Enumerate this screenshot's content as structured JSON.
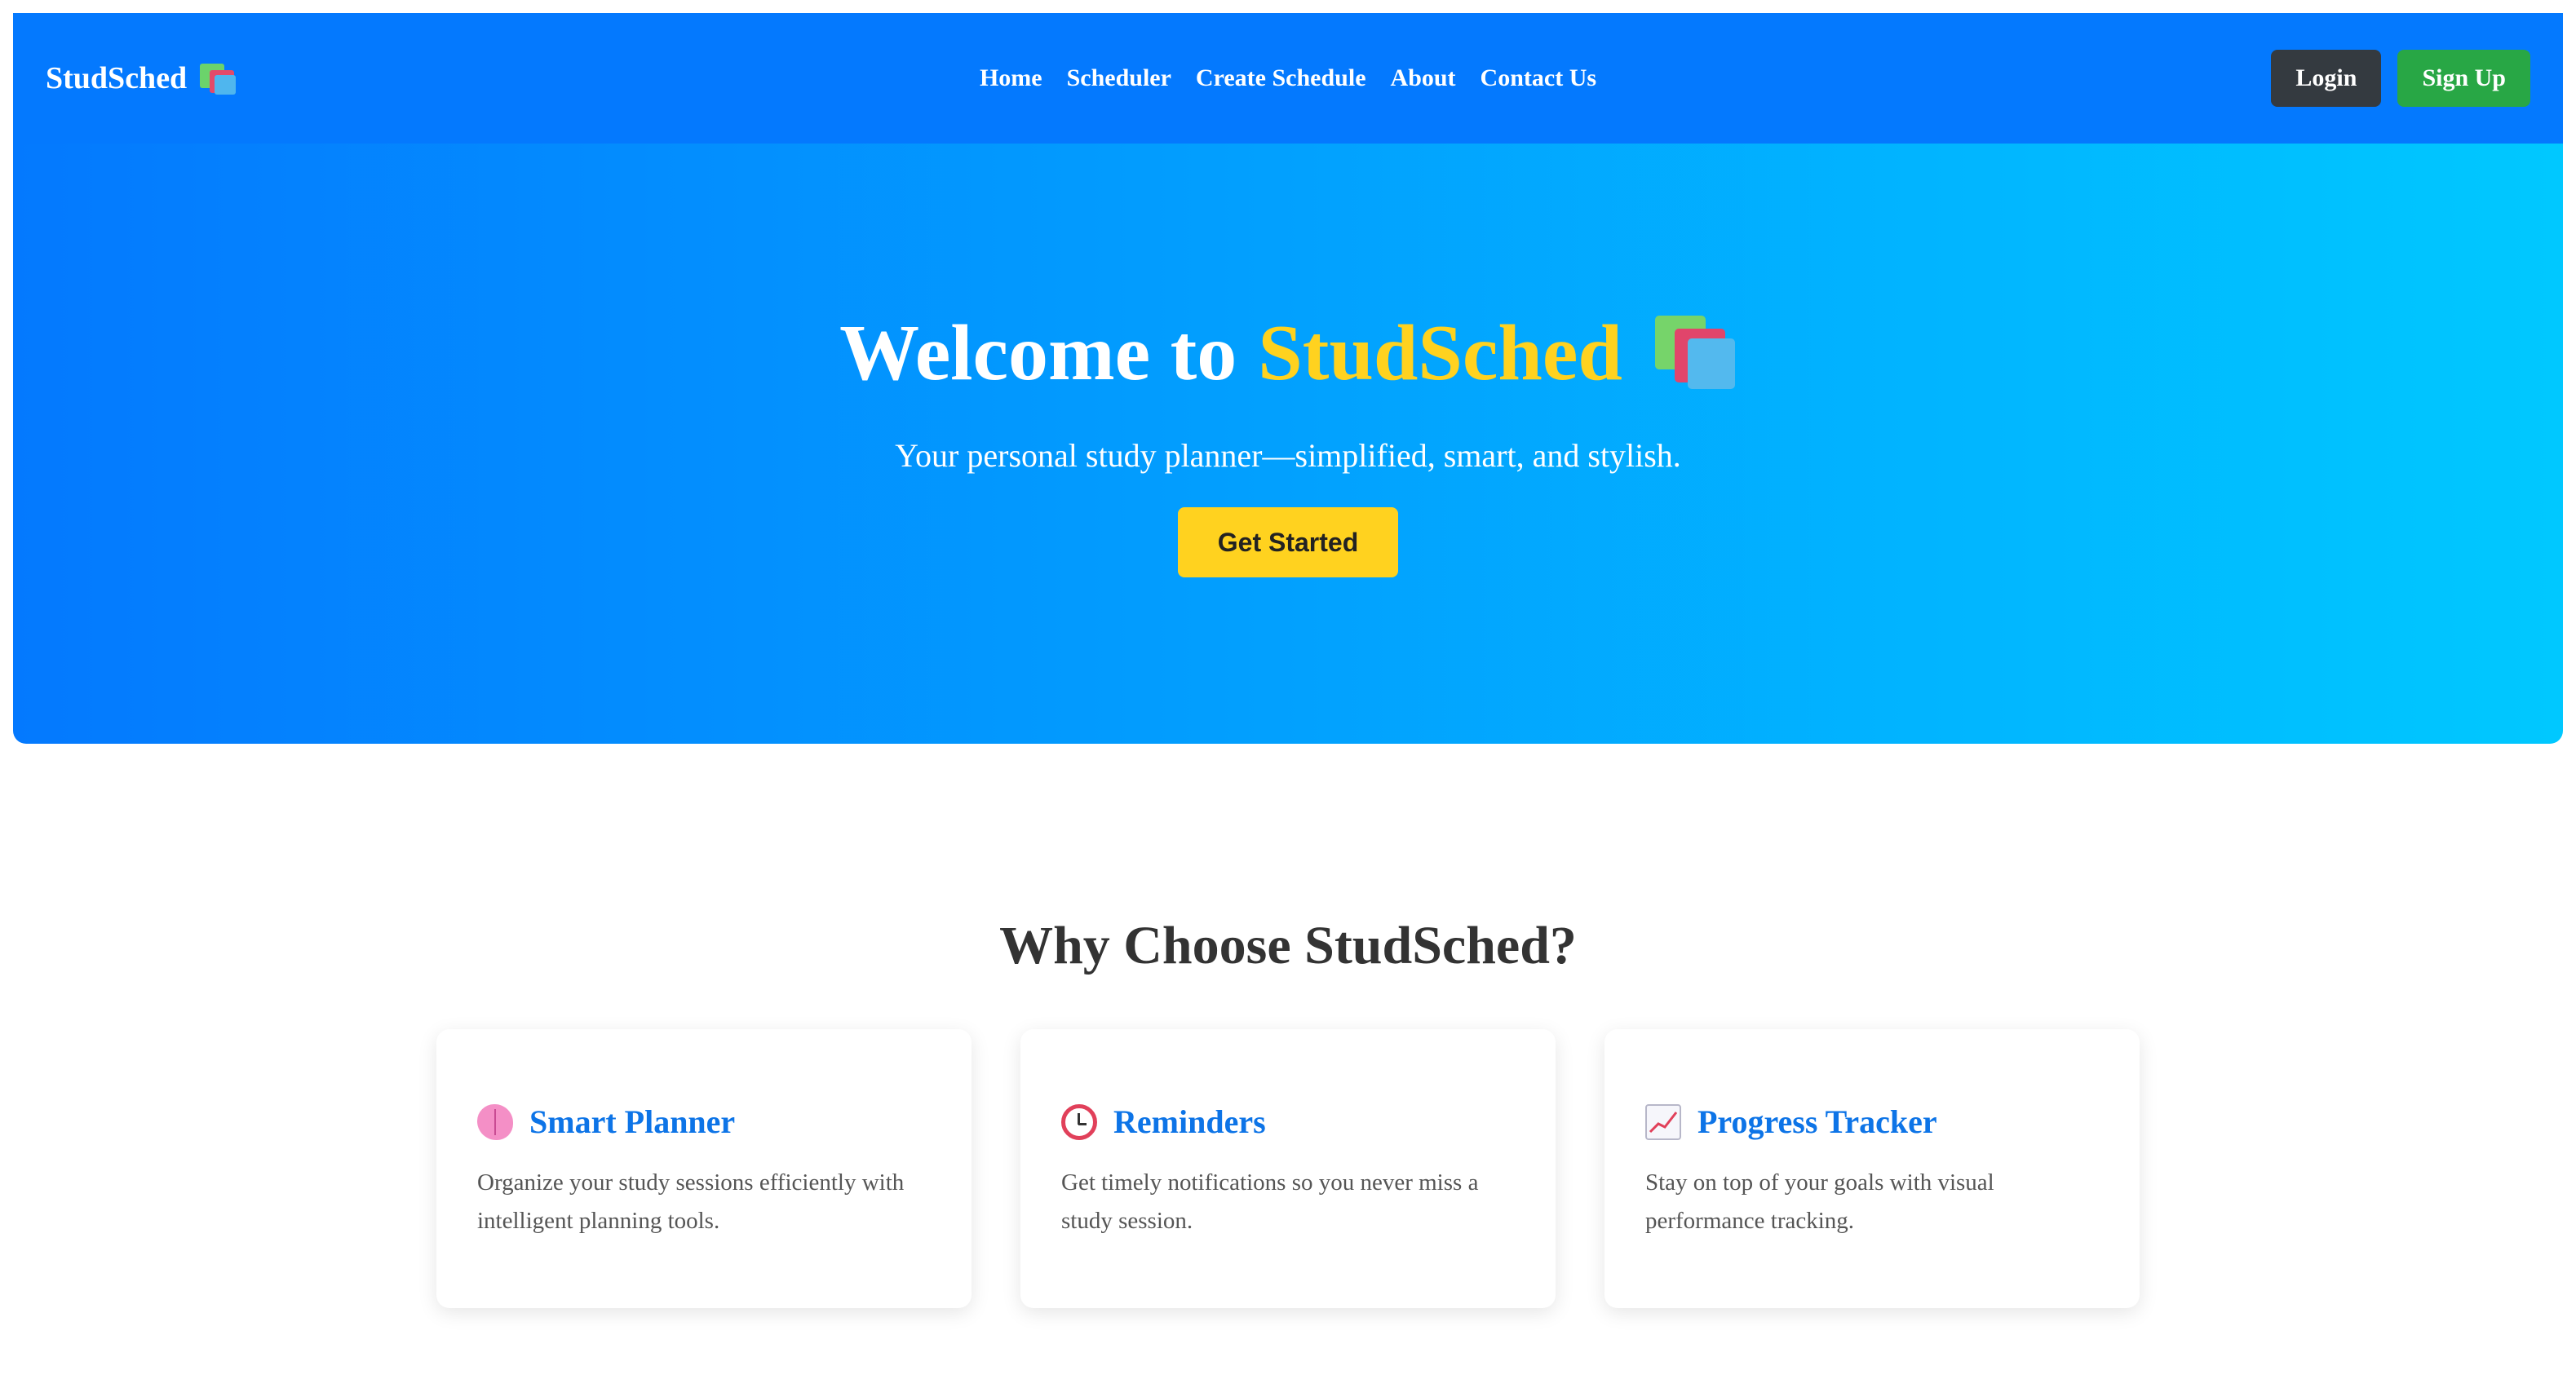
{
  "navbar": {
    "brand": "StudSched",
    "brand_icon": "books-icon",
    "links": [
      "Home",
      "Scheduler",
      "Create Schedule",
      "About",
      "Contact Us"
    ],
    "login_label": "Login",
    "signup_label": "Sign Up"
  },
  "hero": {
    "title_prefix": "Welcome to",
    "title_brand": "StudSched",
    "subtitle": "Your personal study planner—simplified, smart, and stylish.",
    "cta_label": "Get Started"
  },
  "features": {
    "title": "Why Choose StudSched?",
    "cards": [
      {
        "icon": "brain-icon",
        "title": "Smart Planner",
        "desc": "Organize your study sessions efficiently with intelligent planning tools."
      },
      {
        "icon": "alarm-clock-icon",
        "title": "Reminders",
        "desc": "Get timely notifications so you never miss a study session."
      },
      {
        "icon": "chart-icon",
        "title": "Progress Tracker",
        "desc": "Stay on top of your goals with visual performance tracking."
      }
    ]
  },
  "colors": {
    "navbar": "#0479fe",
    "hero_gradient_start": "#0479fe",
    "hero_gradient_end": "#00c8ff",
    "accent_yellow": "#ffd21f",
    "login_bg": "#343a40",
    "signup_bg": "#28a745",
    "card_title": "#0d74e7"
  }
}
